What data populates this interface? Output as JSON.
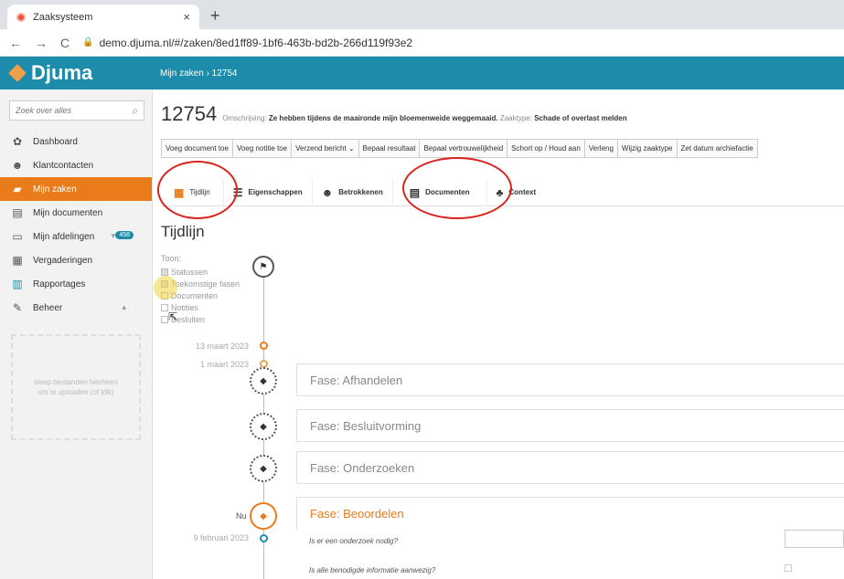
{
  "browser": {
    "tab_title": "Zaaksysteem",
    "tab_close": "×",
    "new_tab": "+",
    "back": "←",
    "forward": "→",
    "reload": "C",
    "url": "demo.djuma.nl/#/zaken/8ed1ff89-1bf6-463b-bd2b-266d119f93e2"
  },
  "app": {
    "logo": "Djuma",
    "breadcrumb": "Mijn zaken › 12754",
    "brand_color": "#1d8caa",
    "accent_color": "#e97b1b"
  },
  "sidebar": {
    "search_placeholder": "Zoek over alles",
    "items": [
      {
        "label": "Dashboard",
        "icon": "dashboard-icon"
      },
      {
        "label": "Klantcontacten",
        "icon": "people-icon"
      },
      {
        "label": "Mijn zaken",
        "icon": "folder-icon",
        "active": true
      },
      {
        "label": "Mijn documenten",
        "icon": "document-icon"
      },
      {
        "label": "Mijn afdelingen",
        "icon": "inbox-icon",
        "badge": "458"
      },
      {
        "label": "Vergaderingen",
        "icon": "calendar-icon"
      },
      {
        "label": "Rapportages",
        "icon": "chart-icon"
      },
      {
        "label": "Beheer",
        "icon": "wrench-icon"
      }
    ],
    "dropzone": "sleep bestanden hierheen om te uploaden (of klik)"
  },
  "case": {
    "number": "12754",
    "desc_label": "Omschrijving:",
    "desc_value": "Ze hebben tijdens de maaironde mijn bloemenweide weggemaaid.",
    "type_label": "Zaaktype:",
    "type_value": "Schade of overlast melden"
  },
  "toolbar": [
    "Voeg document toe",
    "Voeg notitie toe",
    "Verzend bericht ⌄",
    "Bepaal resultaat",
    "Bepaal vertrouwelijkheid",
    "Schort op / Houd aan",
    "Verleng",
    "Wijzig zaaktype",
    "Zet datum archiefactie"
  ],
  "tabs": [
    {
      "label": "Tijdlijn",
      "icon": "calendar-icon"
    },
    {
      "label": "Eigenschappen",
      "icon": "list-icon"
    },
    {
      "label": "Betrokkenen",
      "icon": "people-icon"
    },
    {
      "label": "Documenten",
      "icon": "document-icon"
    },
    {
      "label": "Context",
      "icon": "sitemap-icon"
    }
  ],
  "timeline": {
    "title": "Tijdlijn",
    "show_label": "Toon:",
    "filters": [
      {
        "label": "Statussen",
        "checked": true
      },
      {
        "label": "Toekomstige fasen",
        "checked": true
      },
      {
        "label": "Documenten",
        "checked": false
      },
      {
        "label": "Notities",
        "checked": false
      },
      {
        "label": "Besluiten",
        "checked": false
      }
    ],
    "dates": [
      "13 maart 2023",
      "1 maart 2023",
      "9 februari 2023"
    ],
    "phases": [
      "Fase: Afhandelen",
      "Fase: Besluitvorming",
      "Fase: Onderzoeken",
      "Fase: Beoordelen"
    ],
    "now_label": "Nu",
    "questions": [
      "Is er een onderzoek nodig?",
      "Is alle benodigde informatie aanwezig?"
    ]
  }
}
